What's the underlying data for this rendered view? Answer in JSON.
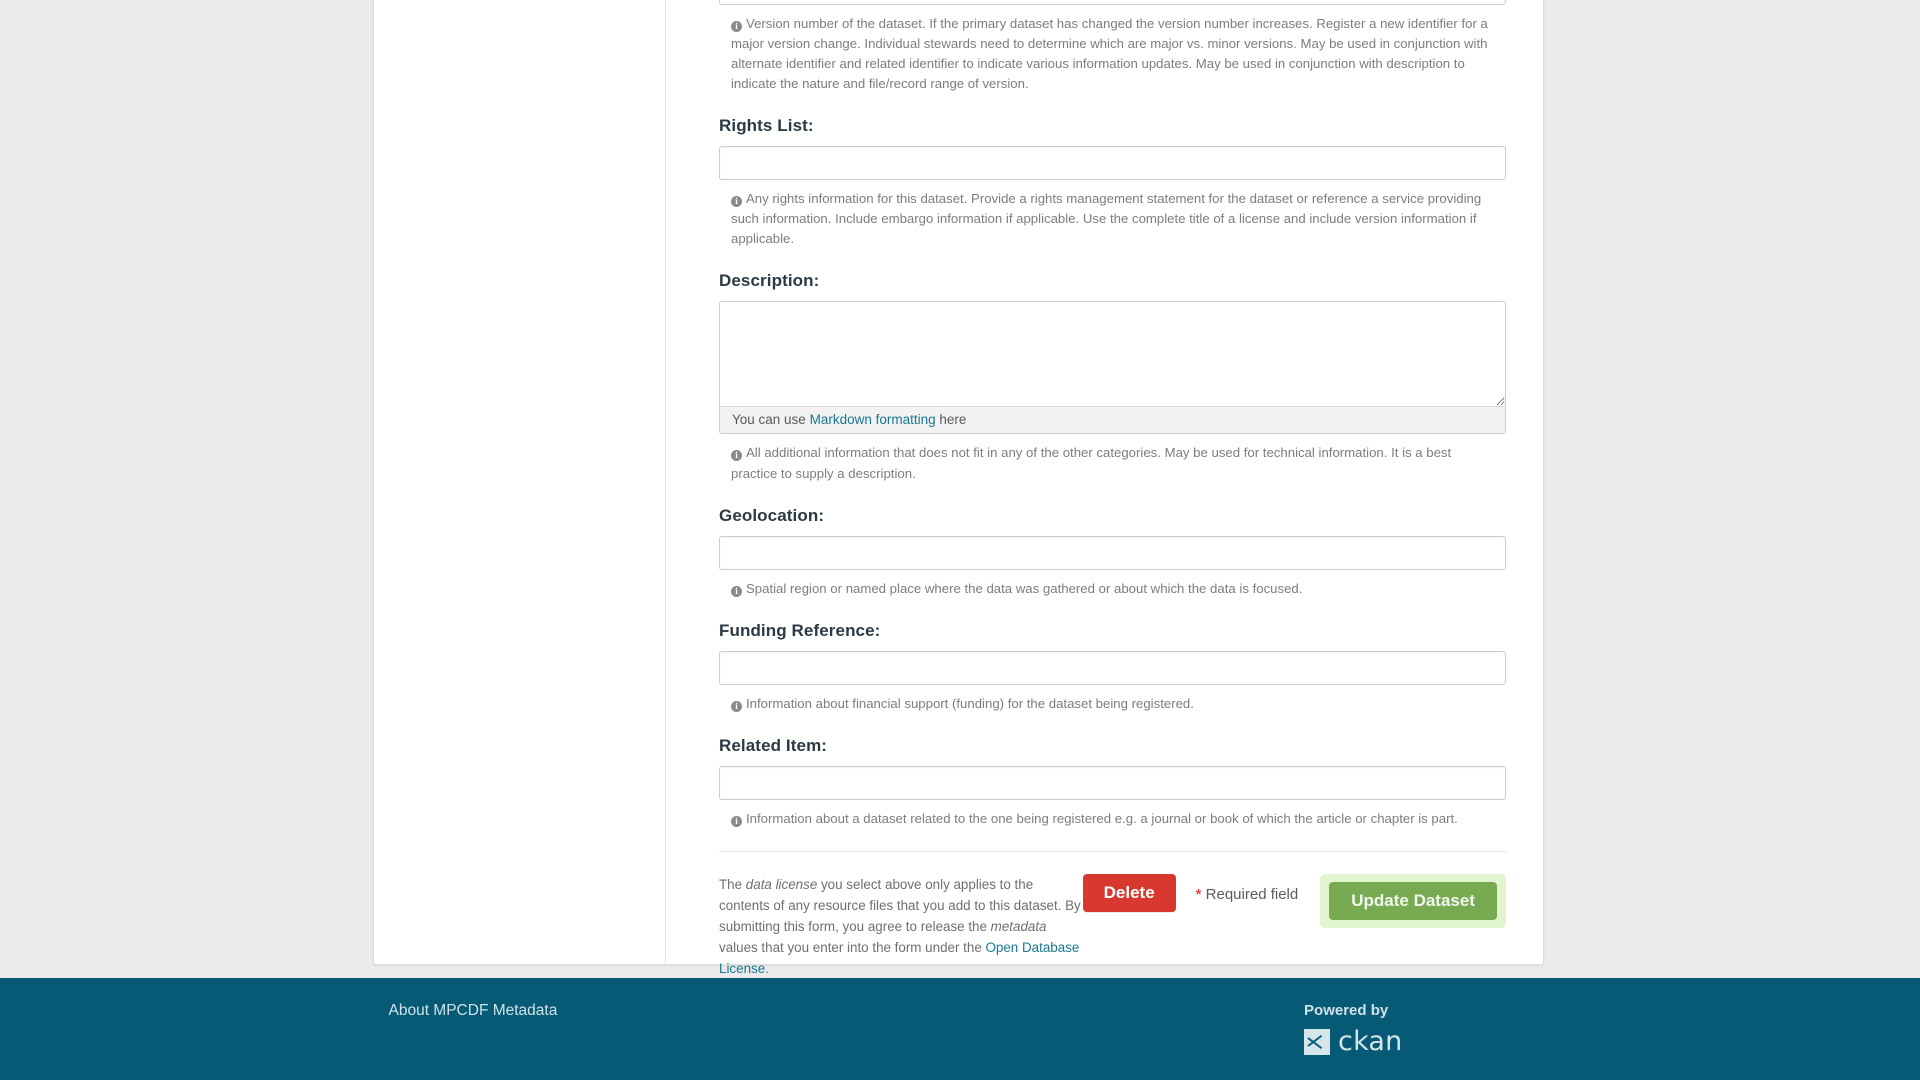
{
  "form": {
    "fields": [
      {
        "name": "version",
        "label": "",
        "value": "",
        "help": "Version number of the dataset. If the primary dataset has changed the version number increases. Register a new identifier for a major version change. Individual stewards need to determine which are major vs. minor versions. May be used in conjunction with alternate identifier and related identifier to indicate various information updates. May be used in conjunction with description to indicate the nature and file/record range of version."
      },
      {
        "name": "rights_list",
        "label": "Rights List:",
        "value": "",
        "help": "Any rights information for this dataset. Provide a rights management statement for the dataset or reference a service providing such information. Include embargo information if applicable. Use the complete title of a license and include version information if applicable."
      },
      {
        "name": "description",
        "label": "Description:",
        "value": "",
        "help": "All additional information that does not fit in any of the other categories. May be used for technical information. It is a best practice to supply a description."
      },
      {
        "name": "geolocation",
        "label": "Geolocation:",
        "value": "",
        "help": "Spatial region or named place where the data was gathered or about which the data is focused."
      },
      {
        "name": "funding_reference",
        "label": "Funding Reference:",
        "value": "",
        "help": "Information about financial support (funding) for the dataset being registered."
      },
      {
        "name": "related_item",
        "label": "Related Item:",
        "value": "",
        "help": "Information about a dataset related to the one being registered e.g. a journal or book of which the article or chapter is part."
      }
    ],
    "editor": {
      "info_prefix": "You can use ",
      "info_link": "Markdown formatting",
      "info_suffix": " here"
    },
    "actions": {
      "license_note_1": "The ",
      "license_note_em1": "data license",
      "license_note_2": " you select above only applies to the contents of any resource files that you add to this dataset. By submitting this form, you agree to release the ",
      "license_note_em2": "metadata",
      "license_note_3": " values that you enter into the form under the ",
      "license_note_link": "Open Database License",
      "license_note_4": ".",
      "delete_label": "Delete",
      "required_star": "*",
      "required_label": " Required field",
      "submit_label": "Update Dataset"
    }
  },
  "footer": {
    "about_label": "About MPCDF Metadata",
    "powered_by": "Powered by",
    "ckan_word": "ckan"
  },
  "colors": {
    "footer_bg": "#065a75",
    "danger": "#d9382f",
    "primary": "#78ab51",
    "primary_glow": "#e0f5cf",
    "link": "#187794"
  }
}
